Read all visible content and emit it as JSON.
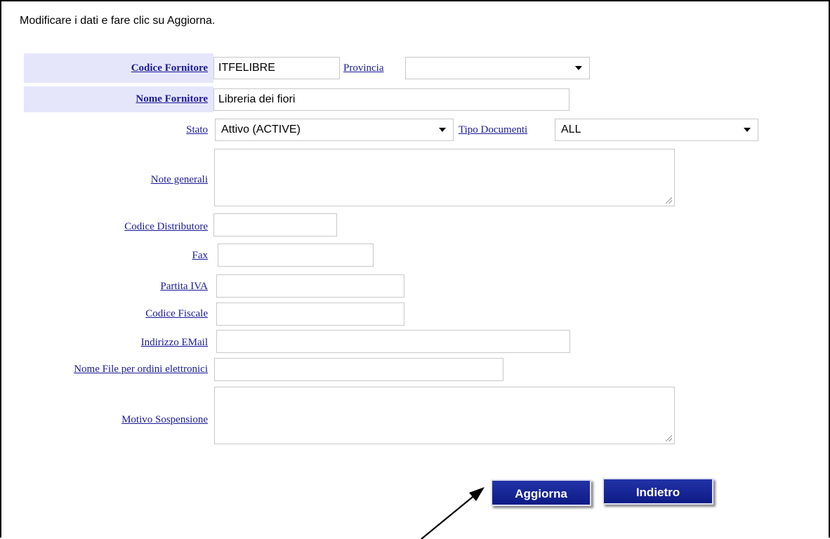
{
  "page": {
    "instruction": "Modificare i dati e fare clic su Aggiorna."
  },
  "form": {
    "codice_fornitore": {
      "label": "Codice Fornitore",
      "value": "ITFELIBRE"
    },
    "provincia": {
      "label": "Provincia",
      "value": ""
    },
    "nome_fornitore": {
      "label": "Nome Fornitore",
      "value": "Libreria dei fiori"
    },
    "stato": {
      "label": "Stato",
      "value": "Attivo (ACTIVE)"
    },
    "tipo_documenti": {
      "label": "Tipo Documenti",
      "value": "ALL"
    },
    "note_generali": {
      "label": "Note generali",
      "value": ""
    },
    "codice_distributore": {
      "label": "Codice Distributore",
      "value": ""
    },
    "fax": {
      "label": "Fax",
      "value": ""
    },
    "partita_iva": {
      "label": "Partita IVA",
      "value": ""
    },
    "codice_fiscale": {
      "label": "Codice Fiscale",
      "value": ""
    },
    "indirizzo_email": {
      "label": "Indirizzo EMail",
      "value": ""
    },
    "nome_file_ordini": {
      "label": "Nome File per ordini elettronici",
      "value": ""
    },
    "motivo_sospensione": {
      "label": "Motivo Sospensione",
      "value": ""
    }
  },
  "actions": {
    "update_label": "Aggiorna",
    "back_label": "Indietro"
  },
  "colors": {
    "link": "#1a1a9a",
    "highlight": "#e6e6fa",
    "button": "#1a2a9e"
  },
  "icons": {
    "dropdown": "chevron-down-icon",
    "resize": "resize-grip-icon",
    "pointer": "arrow-annotation-icon"
  }
}
